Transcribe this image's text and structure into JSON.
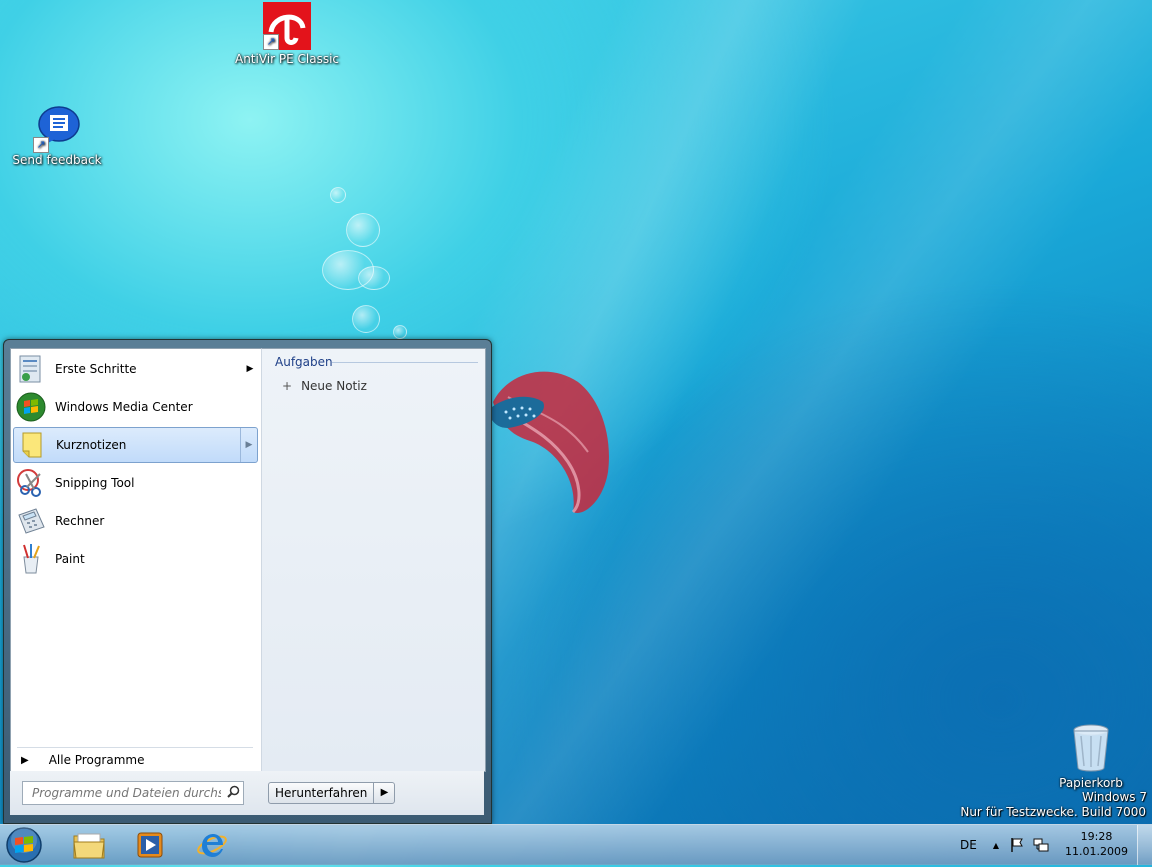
{
  "desktop": {
    "icons": [
      {
        "label": "AntiVir PE Classic",
        "icon": "antivir-umbrella-icon"
      },
      {
        "label": "Send feedback",
        "icon": "feedback-speech-bubble-icon"
      },
      {
        "label": "Papierkorb",
        "icon": "recycle-bin-icon"
      }
    ],
    "watermark": {
      "line1": "Windows 7",
      "line2": "Nur für Testzwecke. Build 7000"
    }
  },
  "start_menu": {
    "programs": [
      {
        "label": "Erste Schritte",
        "icon": "getting-started-icon",
        "has_submenu": true,
        "submenu_arrow": "▶"
      },
      {
        "label": "Windows Media Center",
        "icon": "media-center-icon",
        "has_submenu": false
      },
      {
        "label": "Kurznotizen",
        "icon": "sticky-notes-icon",
        "has_submenu": true,
        "submenu_arrow": "▶",
        "selected": true
      },
      {
        "label": "Snipping Tool",
        "icon": "snipping-tool-icon",
        "has_submenu": false
      },
      {
        "label": "Rechner",
        "icon": "calculator-icon",
        "has_submenu": false
      },
      {
        "label": "Paint",
        "icon": "paint-icon",
        "has_submenu": false
      }
    ],
    "all_programs": {
      "label": "Alle Programme",
      "arrow": "▶"
    },
    "jumplist": {
      "section_title": "Aufgaben",
      "tasks": [
        {
          "label": "Neue Notiz",
          "glyph": "+"
        }
      ]
    },
    "search": {
      "placeholder": "Programme und Dateien durchsu..."
    },
    "shutdown": {
      "label": "Herunterfahren",
      "arrow": "▶"
    }
  },
  "taskbar": {
    "pinned": [
      {
        "name": "explorer",
        "icon": "folder-icon"
      },
      {
        "name": "media-player",
        "icon": "media-player-icon"
      },
      {
        "name": "internet-explorer",
        "icon": "ie-icon"
      }
    ],
    "tray": {
      "language": "DE",
      "expand_arrow": "▲",
      "time": "19:28",
      "date": "11.01.2009"
    }
  },
  "colors": {
    "selection_border": "#7da2ce",
    "jumplist_heading": "#1e3f87"
  }
}
